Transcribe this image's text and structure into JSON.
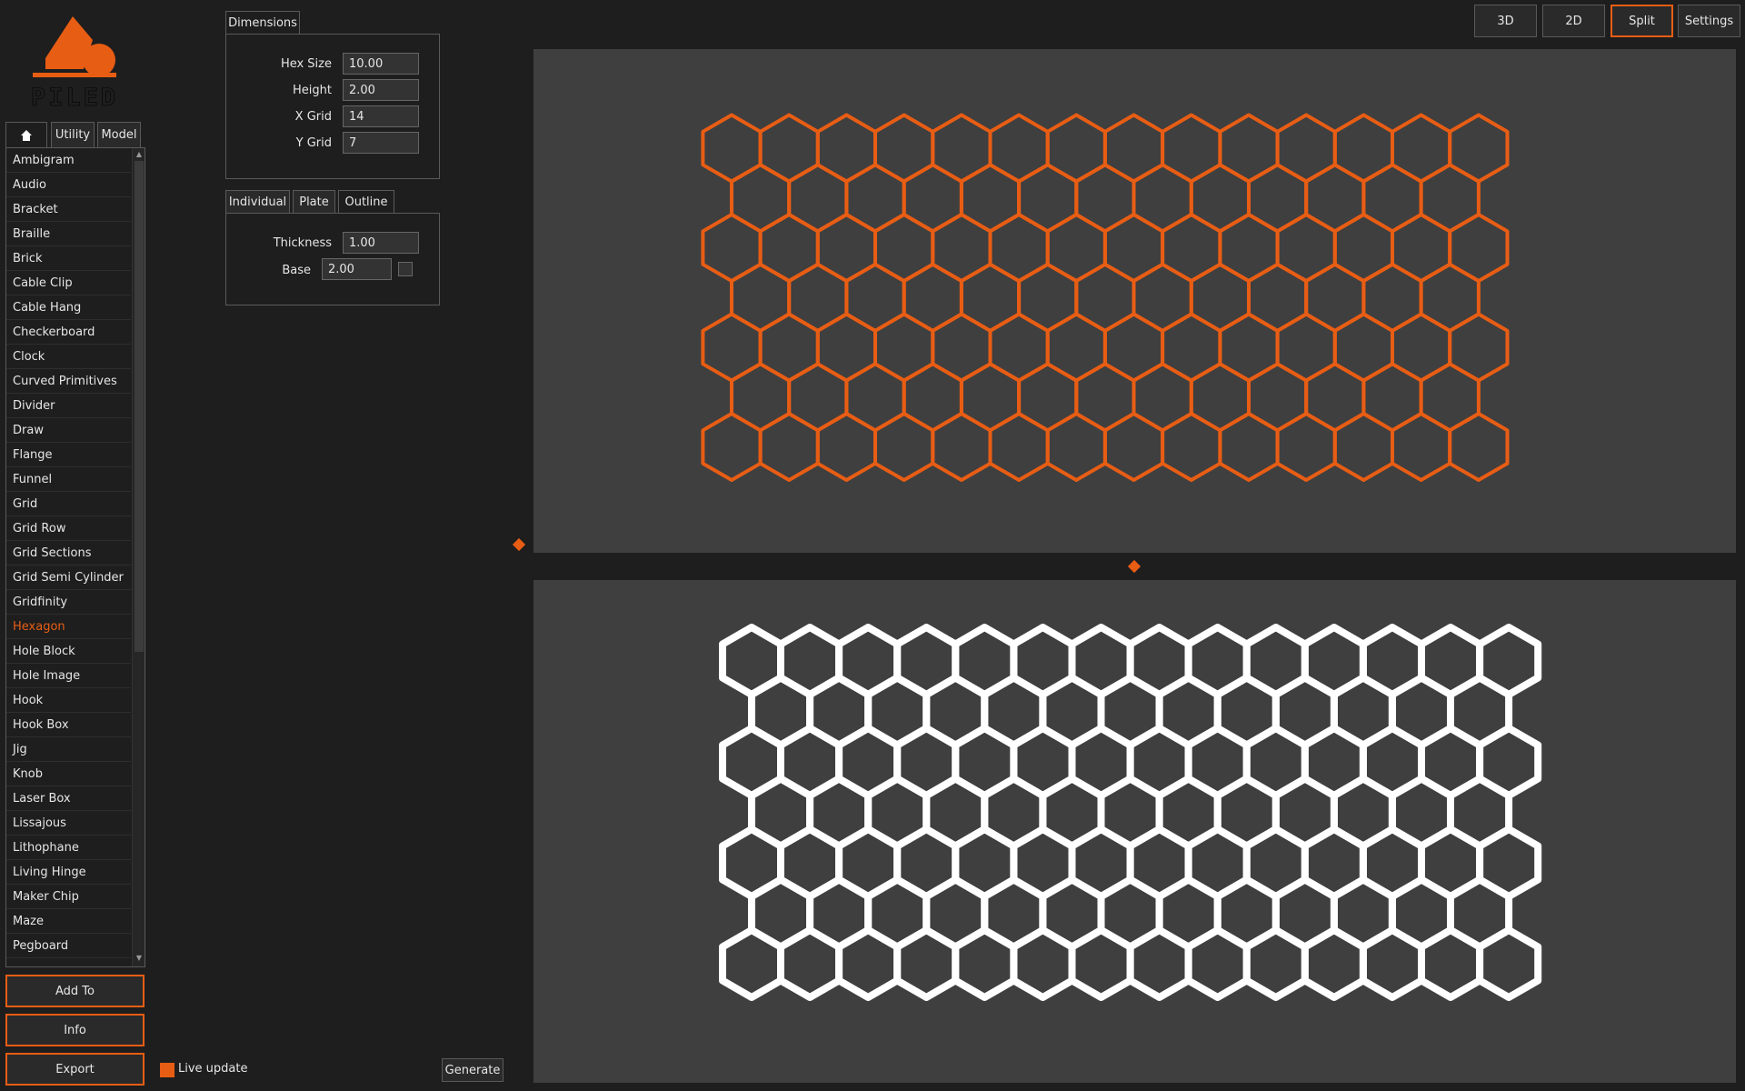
{
  "logo": {
    "text": "PILED"
  },
  "left_tabs": {
    "home_icon": "home-icon",
    "utility": "Utility",
    "model": "Model"
  },
  "model_list": {
    "items": [
      "Ambigram",
      "Audio",
      "Bracket",
      "Braille",
      "Brick",
      "Cable Clip",
      "Cable Hang",
      "Checkerboard",
      "Clock",
      "Curved Primitives",
      "Divider",
      "Draw",
      "Flange",
      "Funnel",
      "Grid",
      "Grid Row",
      "Grid Sections",
      "Grid Semi Cylinder",
      "Gridfinity",
      "Hexagon",
      "Hole Block",
      "Hole Image",
      "Hook",
      "Hook Box",
      "Jig",
      "Knob",
      "Laser Box",
      "Lissajous",
      "Lithophane",
      "Living Hinge",
      "Maker Chip",
      "Maze",
      "Pegboard"
    ],
    "selected": "Hexagon"
  },
  "actions": {
    "add_to": "Add To",
    "info": "Info",
    "export": "Export"
  },
  "live_update": {
    "label": "Live update",
    "checked": true
  },
  "generate": "Generate",
  "dimensions": {
    "tab": "Dimensions",
    "hex_size_label": "Hex Size",
    "hex_size": "10.00",
    "height_label": "Height",
    "height": "2.00",
    "x_grid_label": "X Grid",
    "x_grid": "14",
    "y_grid_label": "Y Grid",
    "y_grid": "7"
  },
  "output_tabs": {
    "individual": "Individual",
    "plate": "Plate",
    "outline": "Outline",
    "active": "Outline"
  },
  "outline": {
    "thickness_label": "Thickness",
    "thickness": "1.00",
    "base_label": "Base",
    "base": "2.00",
    "base_checked": false
  },
  "view_modes": {
    "3d": "3D",
    "2d": "2D",
    "split": "Split",
    "settings": "Settings",
    "active": "Split"
  },
  "colors": {
    "accent": "#e85d14",
    "background": "#1e1e1e",
    "viewport": "#3f3f3f",
    "shape_2d": "#ffffff"
  }
}
